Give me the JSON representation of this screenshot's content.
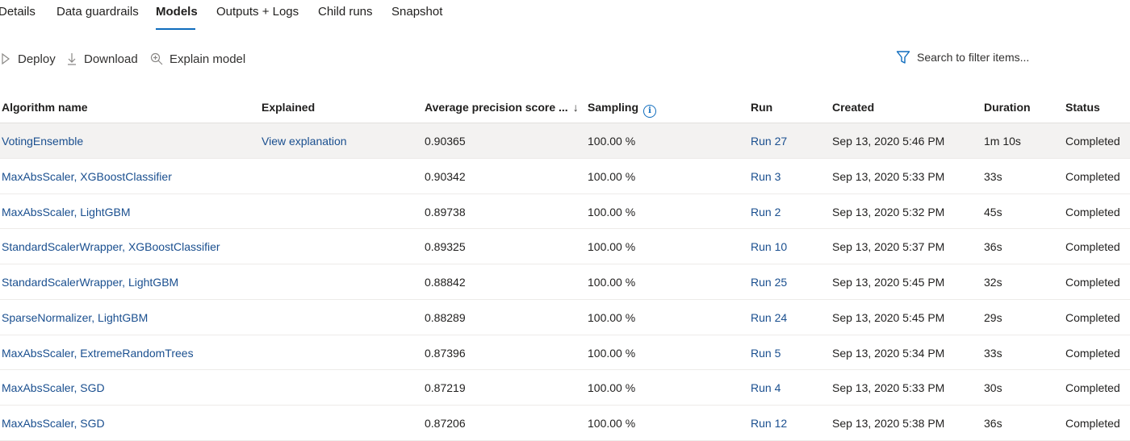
{
  "tabs": [
    "Details",
    "Data guardrails",
    "Models",
    "Outputs + Logs",
    "Child runs",
    "Snapshot"
  ],
  "active_tab": "Models",
  "toolbar": {
    "deploy_label": "Deploy",
    "download_label": "Download",
    "explain_label": "Explain model",
    "search_placeholder": "Search to filter items..."
  },
  "table": {
    "headers": {
      "algorithm": "Algorithm name",
      "explained": "Explained",
      "score": "Average precision score ...",
      "sort_indicator": "↓",
      "sampling": "Sampling",
      "run": "Run",
      "created": "Created",
      "duration": "Duration",
      "status": "Status"
    },
    "rows": [
      {
        "algorithm": "VotingEnsemble",
        "explained": "View explanation",
        "score": "0.90365",
        "sampling": "100.00 %",
        "run": "Run 27",
        "created": "Sep 13, 2020 5:46 PM",
        "duration": "1m 10s",
        "status": "Completed"
      },
      {
        "algorithm": "MaxAbsScaler, XGBoostClassifier",
        "explained": "",
        "score": "0.90342",
        "sampling": "100.00 %",
        "run": "Run 3",
        "created": "Sep 13, 2020 5:33 PM",
        "duration": "33s",
        "status": "Completed"
      },
      {
        "algorithm": "MaxAbsScaler, LightGBM",
        "explained": "",
        "score": "0.89738",
        "sampling": "100.00 %",
        "run": "Run 2",
        "created": "Sep 13, 2020 5:32 PM",
        "duration": "45s",
        "status": "Completed"
      },
      {
        "algorithm": "StandardScalerWrapper, XGBoostClassifier",
        "explained": "",
        "score": "0.89325",
        "sampling": "100.00 %",
        "run": "Run 10",
        "created": "Sep 13, 2020 5:37 PM",
        "duration": "36s",
        "status": "Completed"
      },
      {
        "algorithm": "StandardScalerWrapper, LightGBM",
        "explained": "",
        "score": "0.88842",
        "sampling": "100.00 %",
        "run": "Run 25",
        "created": "Sep 13, 2020 5:45 PM",
        "duration": "32s",
        "status": "Completed"
      },
      {
        "algorithm": "SparseNormalizer, LightGBM",
        "explained": "",
        "score": "0.88289",
        "sampling": "100.00 %",
        "run": "Run 24",
        "created": "Sep 13, 2020 5:45 PM",
        "duration": "29s",
        "status": "Completed"
      },
      {
        "algorithm": "MaxAbsScaler, ExtremeRandomTrees",
        "explained": "",
        "score": "0.87396",
        "sampling": "100.00 %",
        "run": "Run 5",
        "created": "Sep 13, 2020 5:34 PM",
        "duration": "33s",
        "status": "Completed"
      },
      {
        "algorithm": "MaxAbsScaler, SGD",
        "explained": "",
        "score": "0.87219",
        "sampling": "100.00 %",
        "run": "Run 4",
        "created": "Sep 13, 2020 5:33 PM",
        "duration": "30s",
        "status": "Completed"
      },
      {
        "algorithm": "MaxAbsScaler, SGD",
        "explained": "",
        "score": "0.87206",
        "sampling": "100.00 %",
        "run": "Run 12",
        "created": "Sep 13, 2020 5:38 PM",
        "duration": "36s",
        "status": "Completed"
      }
    ]
  },
  "icons": {
    "deploy": "play-outline-icon",
    "download": "download-arrow-icon",
    "explain": "zoom-in-magnifier-icon",
    "search": "funnel-filter-icon",
    "sampling_info": "info-circle-icon"
  },
  "colors": {
    "accent": "#0f6cbd",
    "link": "#1a4f8f",
    "row_highlight": "#f3f2f1"
  }
}
